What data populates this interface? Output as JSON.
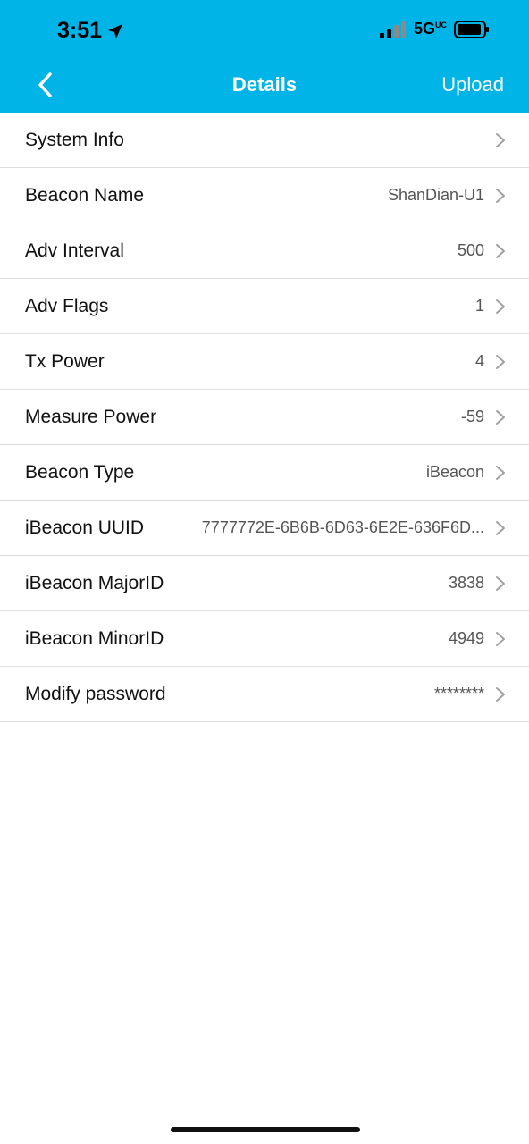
{
  "status_bar": {
    "time": "3:51",
    "network": "5G",
    "network_sup": "UC"
  },
  "nav": {
    "title": "Details",
    "action": "Upload"
  },
  "rows": [
    {
      "label": "System Info",
      "value": ""
    },
    {
      "label": "Beacon Name",
      "value": "ShanDian-U1"
    },
    {
      "label": "Adv Interval",
      "value": "500"
    },
    {
      "label": "Adv Flags",
      "value": "1"
    },
    {
      "label": "Tx Power",
      "value": "4"
    },
    {
      "label": "Measure Power",
      "value": "-59"
    },
    {
      "label": "Beacon Type",
      "value": "iBeacon"
    },
    {
      "label": "iBeacon UUID",
      "value": "7777772E-6B6B-6D63-6E2E-636F6D..."
    },
    {
      "label": "iBeacon MajorID",
      "value": "3838"
    },
    {
      "label": "iBeacon MinorID",
      "value": "4949"
    },
    {
      "label": "Modify password",
      "value": "********"
    }
  ],
  "colors": {
    "header": "#00b4e8",
    "separator": "#dddddd",
    "chevron": "#a0a0a0"
  }
}
